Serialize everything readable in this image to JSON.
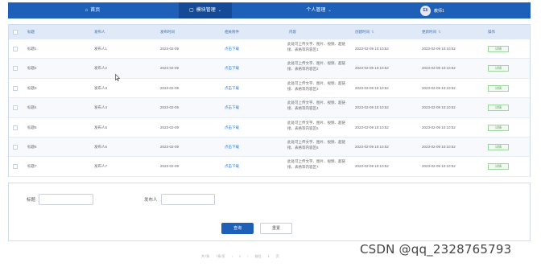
{
  "nav": {
    "home_icon": "home-icon",
    "home": "首页",
    "module_icon": "module-icon",
    "module": "模块管理",
    "personal": "个人管理",
    "avatar_text": "Eli",
    "username": "教师1"
  },
  "table": {
    "headers": [
      "标题",
      "发布人",
      "发布时间",
      "相关附件",
      "内容",
      "创建时间",
      "更新时间",
      "操作"
    ],
    "rows": [
      {
        "title": "标题1",
        "publisher": "发布人1",
        "date": "2023-02-09",
        "attachment": "点击下载",
        "content": "此处可上传文字、图片、视频、超链接、表格等内容区1",
        "created": "2023-02-09 10:10:52",
        "updated": "2023-02-09 10:10:52",
        "action": "详情"
      },
      {
        "title": "标题2",
        "publisher": "发布人2",
        "date": "2023-02-09",
        "attachment": "点击下载",
        "content": "此处可上传文字、图片、视频、超链接、表格等内容区2",
        "created": "2023-02-09 10:10:52",
        "updated": "2023-02-09 10:10:52",
        "action": "详情"
      },
      {
        "title": "标题3",
        "publisher": "发布人3",
        "date": "2023-02-09",
        "attachment": "点击下载",
        "content": "此处可上传文字、图片、视频、超链接、表格等内容区3",
        "created": "2023-02-09 10:10:52",
        "updated": "2023-02-09 10:10:52",
        "action": "详情"
      },
      {
        "title": "标题4",
        "publisher": "发布人4",
        "date": "2023-02-09",
        "attachment": "点击下载",
        "content": "此处可上传文字、图片、视频、超链接、表格等内容区4",
        "created": "2023-02-09 10:10:52",
        "updated": "2023-02-09 10:10:52",
        "action": "详情"
      },
      {
        "title": "标题5",
        "publisher": "发布人5",
        "date": "2023-02-09",
        "attachment": "点击下载",
        "content": "此处可上传文字、图片、视频、超链接、表格等内容区5",
        "created": "2023-02-09 10:10:52",
        "updated": "2023-02-09 10:10:52",
        "action": "详情"
      },
      {
        "title": "标题6",
        "publisher": "发布人6",
        "date": "2023-02-09",
        "attachment": "点击下载",
        "content": "此处可上传文字、图片、视频、超链接、表格等内容区6",
        "created": "2023-02-09 10:10:52",
        "updated": "2023-02-09 10:10:52",
        "action": "详情"
      },
      {
        "title": "标题7",
        "publisher": "发布人7",
        "date": "2023-02-09",
        "attachment": "点击下载",
        "content": "此处可上传文字、图片、视频、超链接、表格等内容区7",
        "created": "2023-02-09 10:10:52",
        "updated": "2023-02-09 10:10:52",
        "action": "详情"
      }
    ]
  },
  "search": {
    "title_label": "标题",
    "publisher_label": "发布人",
    "query_button": "查询",
    "reset_button": "重置"
  },
  "pager": {
    "total": "共7条",
    "page_size": "7条/页",
    "prev": "‹",
    "page": "1",
    "next": "›",
    "goto": "前往",
    "goto_page": "1",
    "page_suffix": "页"
  },
  "watermark": "CSDN @qq_2328765793",
  "colors": {
    "nav_bg": "#1e5fb8",
    "header_bg": "#dfe9f7",
    "link": "#2d7be0",
    "success": "#5aa85a"
  }
}
